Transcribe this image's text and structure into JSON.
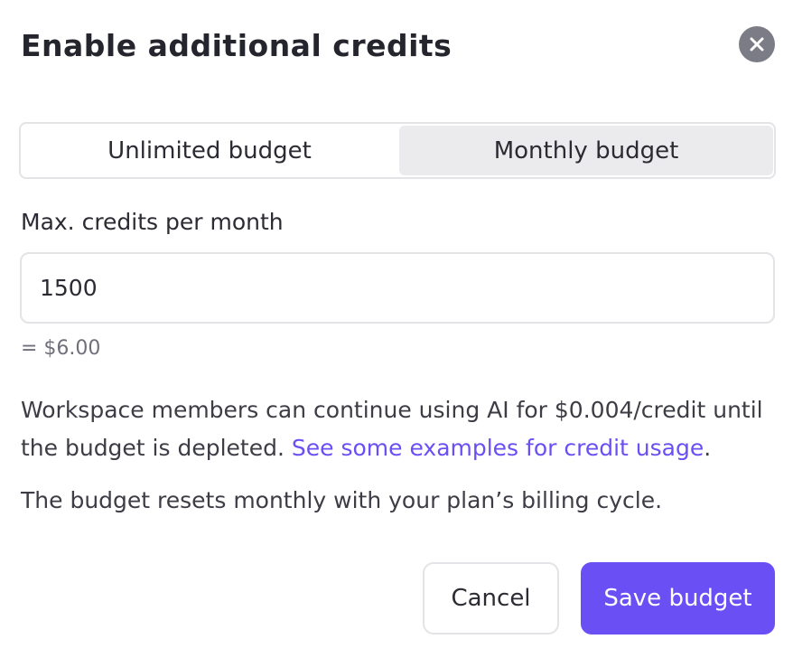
{
  "dialog": {
    "title": "Enable additional credits",
    "close_icon": "close-icon"
  },
  "budget_toggle": {
    "options": [
      {
        "label": "Unlimited budget",
        "selected": false
      },
      {
        "label": "Monthly budget",
        "selected": true
      }
    ]
  },
  "credits_field": {
    "label": "Max. credits per month",
    "value": "1500",
    "conversion": "= $6.00"
  },
  "description": {
    "text": "Workspace members can continue using AI for $0.004/credit until the budget is depleted.",
    "link_text": "See some examples for credit usage",
    "trailing": "."
  },
  "reset_note": "The budget resets monthly with your plan’s billing cycle.",
  "actions": {
    "cancel_label": "Cancel",
    "save_label": "Save budget"
  },
  "colors": {
    "accent": "#6a4ff5",
    "close_bg": "#7c7c86",
    "selected_segment_bg": "#ebebee"
  }
}
